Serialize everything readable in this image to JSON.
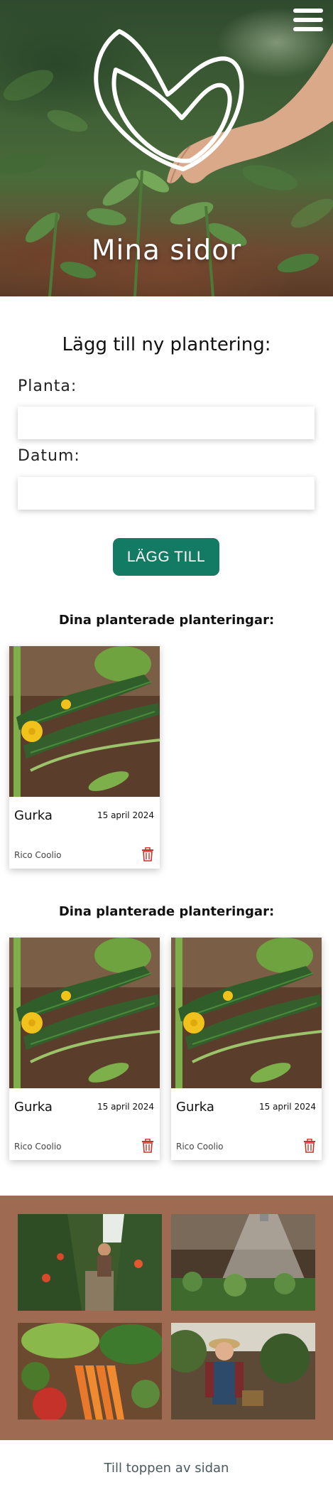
{
  "hero": {
    "title": "Mina sidor",
    "menu_icon": "hamburger-menu-icon",
    "logo_icon": "leaf-heart-logo-icon"
  },
  "form": {
    "title": "Lägg till ny plantering:",
    "plant_label": "Planta:",
    "plant_value": "",
    "date_label": "Datum:",
    "date_value": "",
    "submit_label": "LÄGG TILL"
  },
  "sections": [
    {
      "heading": "Dina planterade planteringar:",
      "cards": [
        {
          "name": "Gurka",
          "date": "15 april 2024",
          "user": "Rico Coolio",
          "delete_icon": "trash-icon"
        }
      ]
    },
    {
      "heading": "Dina planterade planteringar:",
      "cards": [
        {
          "name": "Gurka",
          "date": "15 april 2024",
          "user": "Rico Coolio",
          "delete_icon": "trash-icon"
        },
        {
          "name": "Gurka",
          "date": "15 april 2024",
          "user": "Rico Coolio",
          "delete_icon": "trash-icon"
        }
      ]
    }
  ],
  "gallery": {
    "background": "#9e6b52",
    "images": [
      "pepper-greenhouse-image",
      "watering-seedlings-image",
      "vegetables-crate-image",
      "farmer-woman-image"
    ]
  },
  "footer": {
    "to_top": "Till toppen av sidan"
  },
  "colors": {
    "accent": "#137a64",
    "delete": "#c0392b",
    "gallery": "#9e6b52"
  }
}
